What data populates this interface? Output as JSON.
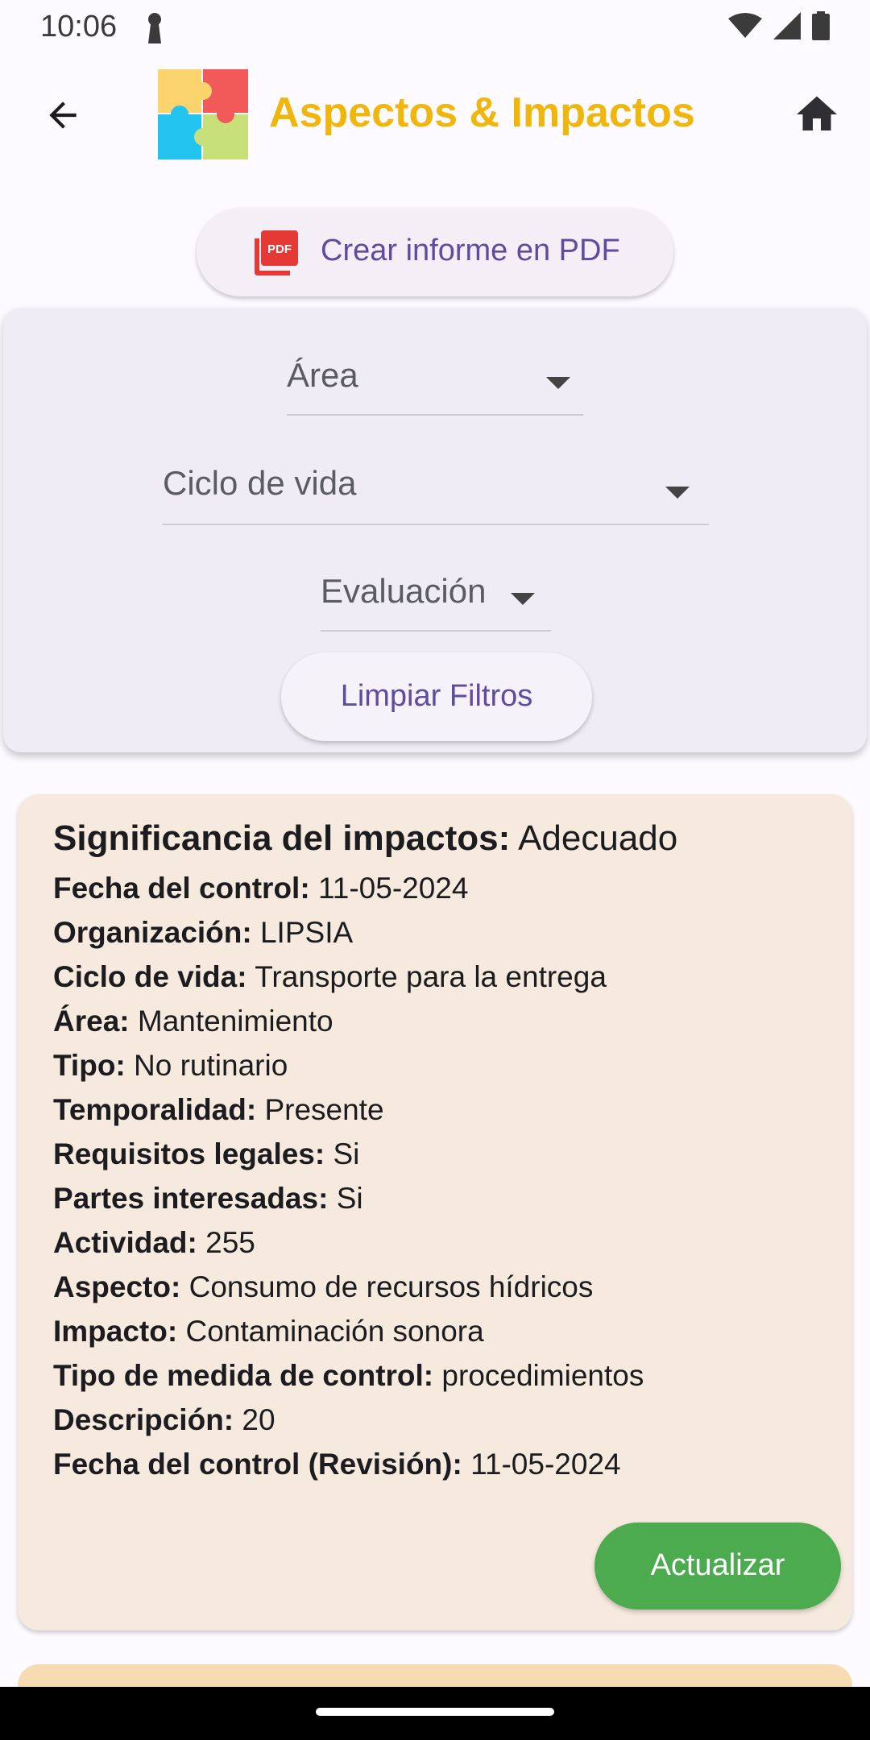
{
  "status_bar": {
    "time": "10:06"
  },
  "app_bar": {
    "title": "Aspectos & Impactos",
    "title_color": "#f0b60c"
  },
  "actions": {
    "pdf_label": "Crear informe en PDF",
    "clear_filters_label": "Limpiar Filtros",
    "update_label": "Actualizar"
  },
  "filters": {
    "area": "Área",
    "lifecycle": "Ciclo de vida",
    "evaluation": "Evaluación"
  },
  "record": {
    "title_label": "Significancia del impactos:",
    "title_value": "Adecuado",
    "fields": [
      {
        "label": "Fecha del control:",
        "value": "11-05-2024"
      },
      {
        "label": "Organización:",
        "value": "LIPSIA"
      },
      {
        "label": "Ciclo de vida:",
        "value": "Transporte para la entrega"
      },
      {
        "label": "Área:",
        "value": "Mantenimiento"
      },
      {
        "label": "Tipo:",
        "value": "No rutinario"
      },
      {
        "label": "Temporalidad:",
        "value": "Presente"
      },
      {
        "label": "Requisitos legales:",
        "value": "Si"
      },
      {
        "label": "Partes interesadas:",
        "value": "Si"
      },
      {
        "label": "Actividad:",
        "value": "255"
      },
      {
        "label": "Aspecto:",
        "value": "Consumo de recursos hídricos"
      },
      {
        "label": "Impacto:",
        "value": "Contaminación sonora"
      },
      {
        "label": "Tipo de medida de control:",
        "value": "procedimientos"
      },
      {
        "label": "Descripción:",
        "value": "20"
      },
      {
        "label": "Fecha del control (Revisión):",
        "value": "11-05-2024"
      }
    ]
  },
  "colors": {
    "accent": "#5e4c9e",
    "card_bg": "#f5eadd",
    "next_card_bg": "#f7dcb3",
    "update_green": "#4caa4f",
    "filters_bg": "#efecf5"
  },
  "icons": {
    "back": "arrow-back-icon",
    "home": "home-icon",
    "pdf": "pdf-icon",
    "logo": "puzzle-logo-icon",
    "wifi": "wifi-icon",
    "signal": "signal-icon",
    "battery": "battery-icon",
    "lock": "lock-icon"
  }
}
